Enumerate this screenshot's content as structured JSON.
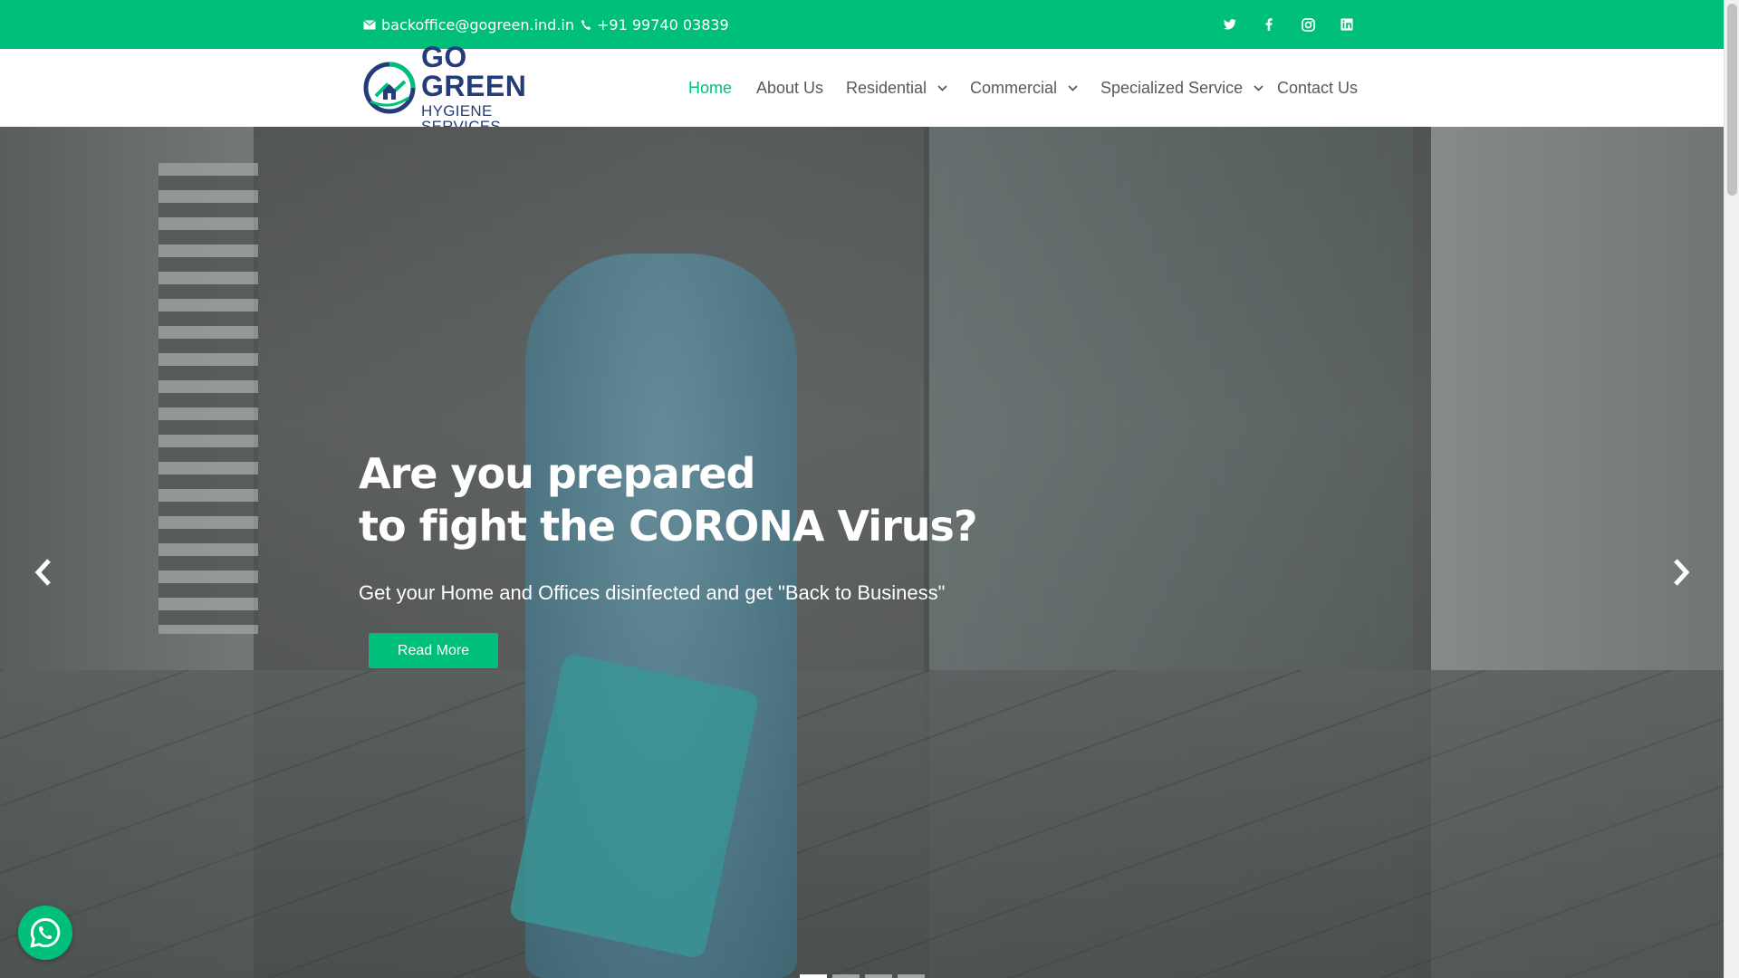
{
  "topbar": {
    "email": "backoffice@gogreen.ind.in",
    "phone": "+91 99740 03839",
    "social": [
      "twitter-icon",
      "facebook-icon",
      "instagram-icon",
      "linkedin-icon"
    ]
  },
  "logo": {
    "title": "GO GREEN",
    "subtitle": "HYGIENE SERVICES"
  },
  "nav": {
    "items": [
      {
        "label": "Home",
        "active": true,
        "dropdown": false
      },
      {
        "label": "About Us",
        "active": false,
        "dropdown": false
      },
      {
        "label": "Residential",
        "active": false,
        "dropdown": true
      },
      {
        "label": "Commercial",
        "active": false,
        "dropdown": true
      },
      {
        "label": "Specialized Service",
        "active": false,
        "dropdown": true
      },
      {
        "label": "Contact Us",
        "active": false,
        "dropdown": false
      }
    ]
  },
  "hero": {
    "line1": "Are you prepared",
    "line2": "to fight the CORONA Virus?",
    "subtitle": "Get your Home and Offices disinfected and get \"Back to Business\"",
    "button": "Read More",
    "slide_count": 4,
    "active_slide": 1
  },
  "colors": {
    "accent": "#00bf7a",
    "brand_navy": "#243c78",
    "nav_text": "#595959"
  }
}
